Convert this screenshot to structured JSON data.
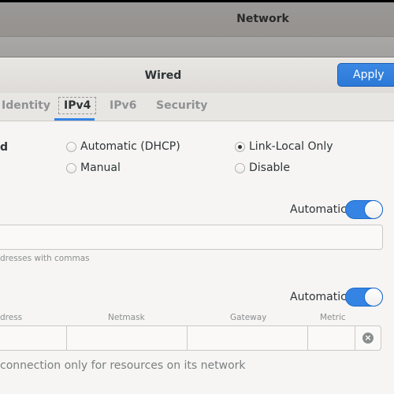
{
  "background_window": {
    "title": "Network"
  },
  "dialog": {
    "title": "Wired",
    "apply_label": "Apply"
  },
  "tabs": [
    {
      "label": "Identity",
      "active": false
    },
    {
      "label": "IPv4",
      "active": true
    },
    {
      "label": "IPv6",
      "active": false
    },
    {
      "label": "Security",
      "active": false
    }
  ],
  "ipv4": {
    "method_label": "d",
    "methods": [
      {
        "label": "Automatic (DHCP)",
        "selected": false
      },
      {
        "label": "Manual",
        "selected": false
      },
      {
        "label": "Link-Local Only",
        "selected": true
      },
      {
        "label": "Disable",
        "selected": false
      }
    ],
    "dns": {
      "automatic_label": "Automatic",
      "automatic_on": true,
      "value": "",
      "hint": "dresses with commas"
    },
    "routes": {
      "automatic_label": "Automatic",
      "automatic_on": true,
      "columns": [
        "dress",
        "Netmask",
        "Gateway",
        "Metric"
      ],
      "row": {
        "address": "",
        "netmask": "",
        "gateway": "",
        "metric": ""
      },
      "footnote": "connection only for resources on its network"
    }
  },
  "colors": {
    "accent": "#3584e4",
    "background": "#f6f5f4",
    "text": "#2e3436",
    "dim_text": "#8b8e8f"
  }
}
